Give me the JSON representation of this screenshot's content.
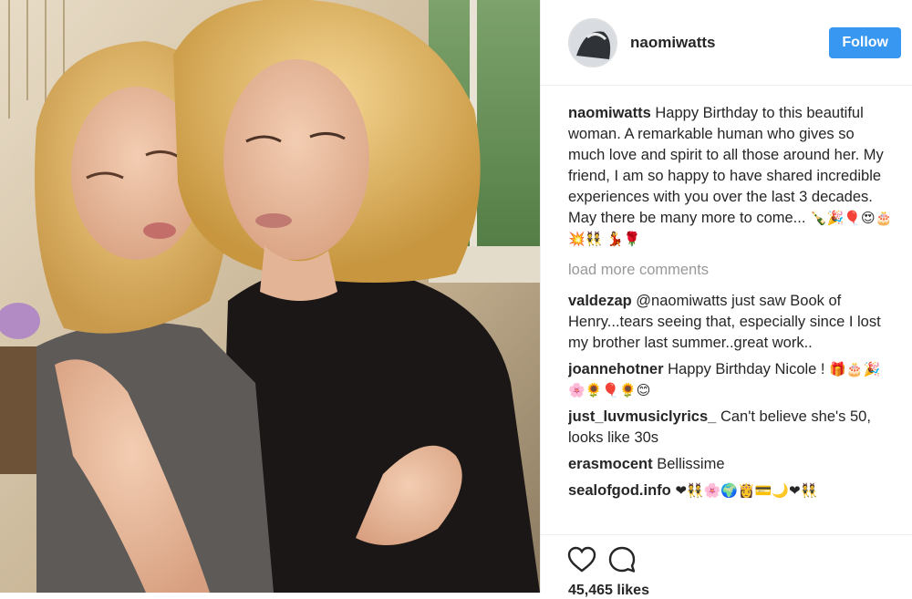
{
  "post": {
    "username": "naomiwatts",
    "follow_label": "Follow",
    "caption_user": "naomiwatts",
    "caption_text": "Happy Birthday to this beautiful woman. A remarkable human who gives so much love and spirit to all those around her. My friend, I am so happy to have shared incredible experiences with you over the last 3 decades. May there be many more to come... ",
    "caption_emoji": "🍾🎉🎈😍🎂💥👯 💃🌹",
    "load_more": "load more comments",
    "likes": "45,465 likes"
  },
  "comments": [
    {
      "user": "valdezap",
      "text": "@naomiwatts just saw Book of Henry...tears seeing that, especially since I lost my brother last summer..great work.."
    },
    {
      "user": "joannehotner",
      "text": "Happy Birthday Nicole ! ",
      "emoji": "🎁🎂🎉🌸🌻🎈🌻😊"
    },
    {
      "user": "just_luvmusiclyrics_",
      "text": "Can't believe she's 50, looks like 30s"
    },
    {
      "user": "erasmocent",
      "text": "Bellissime"
    },
    {
      "user": "sealofgod.info",
      "text": "",
      "emoji": "❤👯🌸🌍👸💳🌙❤👯"
    }
  ],
  "icons": {
    "like": "heart-outline-icon",
    "comment": "speech-bubble-icon"
  },
  "colors": {
    "follow_button": "#3897f0",
    "muted_text": "#999999"
  }
}
